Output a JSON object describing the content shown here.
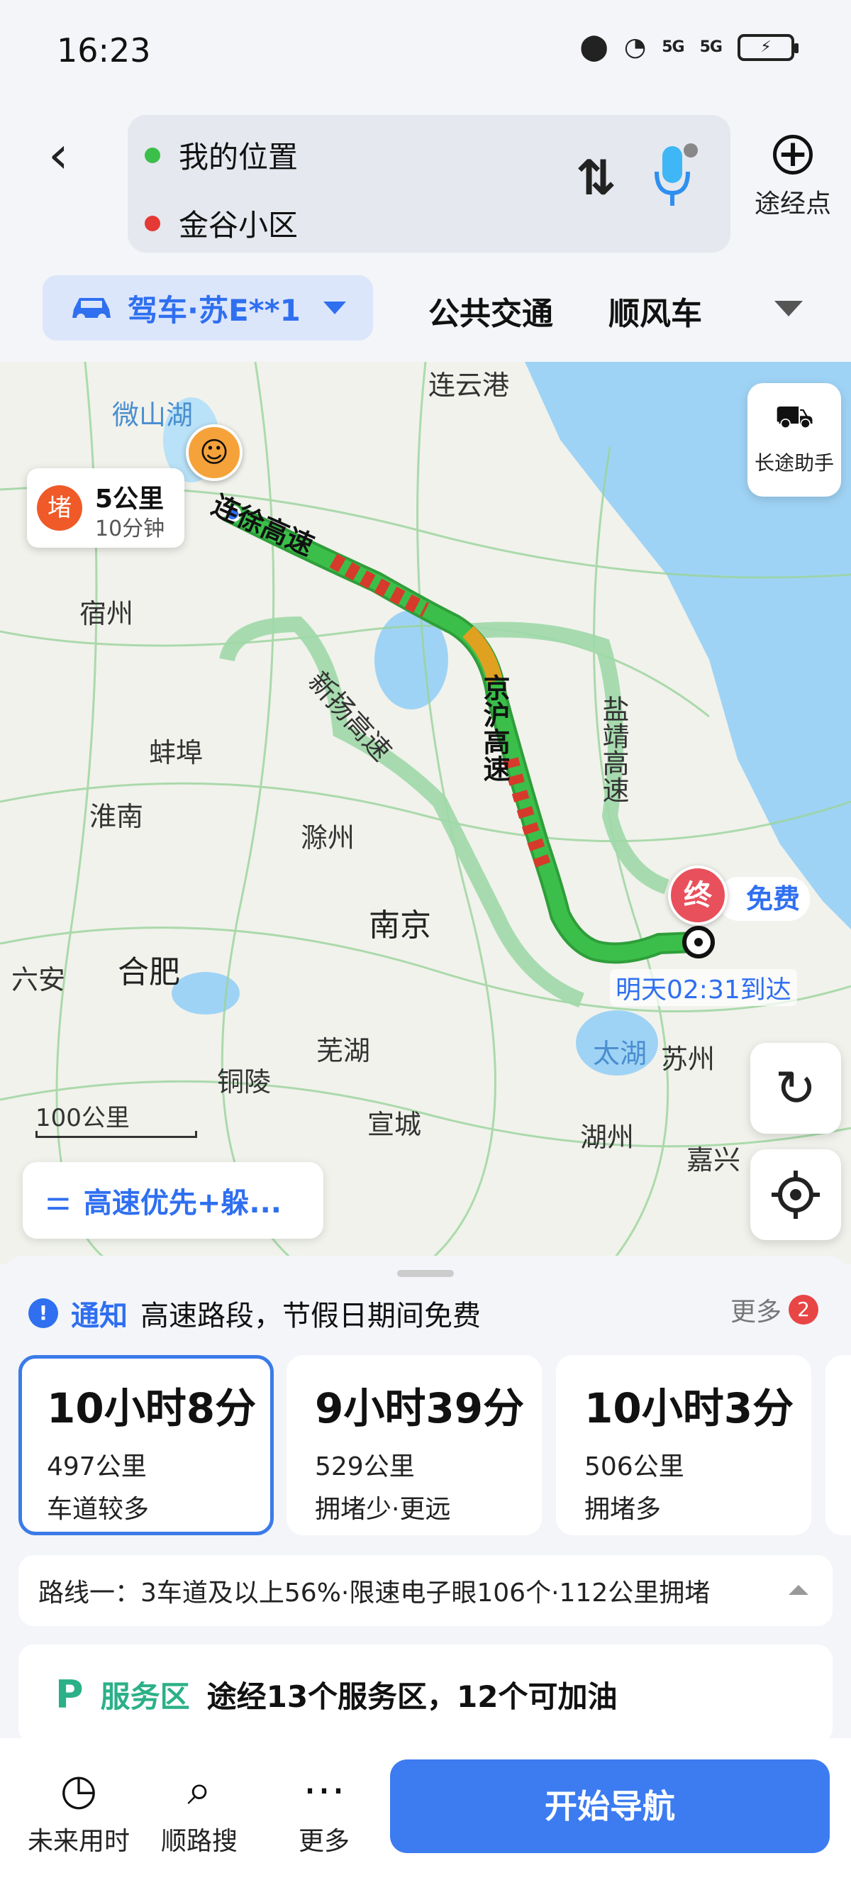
{
  "status_bar": {
    "time": "16:23",
    "signal1": "5G",
    "signal2": "5G",
    "wifi_note": "6"
  },
  "route": {
    "origin": "我的位置",
    "destination": "金谷小区",
    "via_label": "途经点"
  },
  "modes": {
    "drive_label": "驾车·苏E**1",
    "transit": "公共交通",
    "carpool": "顺风车"
  },
  "map": {
    "places": [
      {
        "name": "连云港"
      },
      {
        "name": "微山湖"
      },
      {
        "name": "宿州"
      },
      {
        "name": "蚌埠"
      },
      {
        "name": "淮南"
      },
      {
        "name": "滁州"
      },
      {
        "name": "南京"
      },
      {
        "name": "合肥"
      },
      {
        "name": "六安"
      },
      {
        "name": "芜湖"
      },
      {
        "name": "铜陵"
      },
      {
        "name": "宣城"
      },
      {
        "name": "湖州"
      },
      {
        "name": "嘉兴"
      },
      {
        "name": "苏州"
      },
      {
        "name": "太湖"
      }
    ],
    "roads": [
      "连徐高速",
      "新扬高速",
      "京沪高速",
      "盐靖高速"
    ],
    "jam": {
      "badge": "堵",
      "distance": "5公里",
      "duration": "10分钟"
    },
    "end_badge": "终",
    "free_label": "免费",
    "arrival": "明天02:31到达",
    "longtrip_label": "长途助手",
    "scale_label": "100公里",
    "preference": "高速优先+躲..."
  },
  "notice": {
    "title": "通知",
    "text": "高速路段，节假日期间免费",
    "more_label": "更多",
    "more_count": "2"
  },
  "routes": [
    {
      "time": "10小时8分",
      "distance": "497公里",
      "note": "车道较多"
    },
    {
      "time": "9小时39分",
      "distance": "529公里",
      "note": "拥堵少·更远"
    },
    {
      "time": "10小时3分",
      "distance": "506公里",
      "note": "拥堵多"
    }
  ],
  "summary": "路线一：3车道及以上56%·限速电子眼106个·112公里拥堵",
  "service": {
    "title": "服务区",
    "text": "途经13个服务区，12个可加油"
  },
  "bottom": {
    "future": "未来用时",
    "search": "顺路搜",
    "more": "更多",
    "start": "开始导航"
  },
  "colors": {
    "accent": "#2f6ff0",
    "jam": "#ef5a28",
    "route_green": "#3bbf4a"
  }
}
